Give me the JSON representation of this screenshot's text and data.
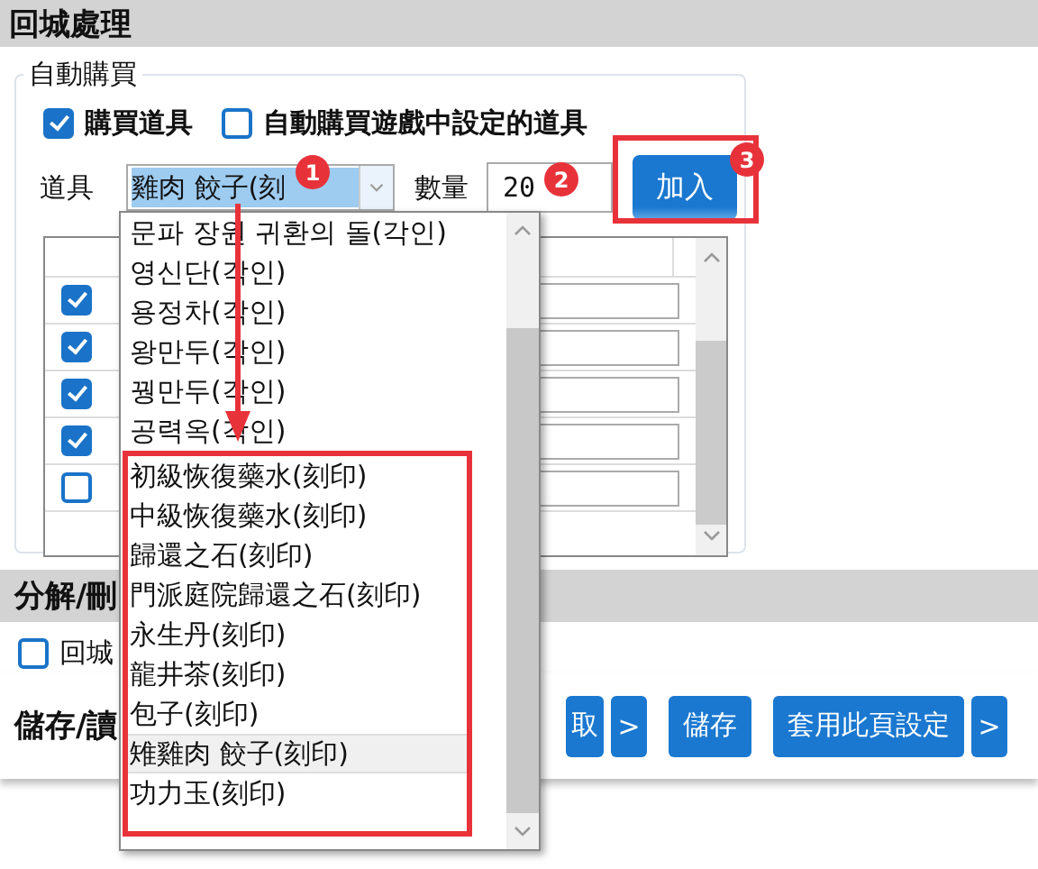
{
  "title": "回城處理",
  "auto_buy": {
    "legend": "自動購買",
    "options": [
      {
        "label": "購買道具",
        "checked": true
      },
      {
        "label": "自動購買遊戲中設定的道具",
        "checked": false
      }
    ],
    "item_label": "道具",
    "item_value": "雞肉 餃子(刻",
    "quantity_label": "數量",
    "quantity_value": "20",
    "add_button": "加入",
    "rows": [
      {
        "checked": true
      },
      {
        "checked": true
      },
      {
        "checked": true
      },
      {
        "checked": true
      },
      {
        "checked": false
      }
    ]
  },
  "dropdown": {
    "items": [
      {
        "label": "문파 장원 귀환의 돌(각인)",
        "selected": false
      },
      {
        "label": "영신단(각인)",
        "selected": false
      },
      {
        "label": "용정차(각인)",
        "selected": false
      },
      {
        "label": "왕만두(각인)",
        "selected": false
      },
      {
        "label": "꿩만두(각인)",
        "selected": false
      },
      {
        "label": "공력옥(각인)",
        "selected": false
      },
      {
        "label": "初級恢復藥水(刻印)",
        "selected": false
      },
      {
        "label": "中級恢復藥水(刻印)",
        "selected": false
      },
      {
        "label": "歸還之石(刻印)",
        "selected": false
      },
      {
        "label": "門派庭院歸還之石(刻印)",
        "selected": false
      },
      {
        "label": "永生丹(刻印)",
        "selected": false
      },
      {
        "label": "龍井茶(刻印)",
        "selected": false
      },
      {
        "label": "包子(刻印)",
        "selected": false
      },
      {
        "label": "雉雞肉 餃子(刻印)",
        "selected": true
      },
      {
        "label": "功力玉(刻印)",
        "selected": false
      }
    ]
  },
  "badges": [
    "1",
    "2",
    "3"
  ],
  "section2": {
    "title": "分解/刪",
    "option": {
      "label": "回城",
      "checked": false
    }
  },
  "bottom": {
    "label": "儲存/讀",
    "buttons": [
      {
        "label": "取",
        "kind": "text"
      },
      {
        "label": ">",
        "kind": "arrow"
      },
      {
        "label": "儲存",
        "kind": "text"
      },
      {
        "label": "套用此頁設定",
        "kind": "text"
      },
      {
        "label": ">",
        "kind": "arrow"
      }
    ]
  }
}
